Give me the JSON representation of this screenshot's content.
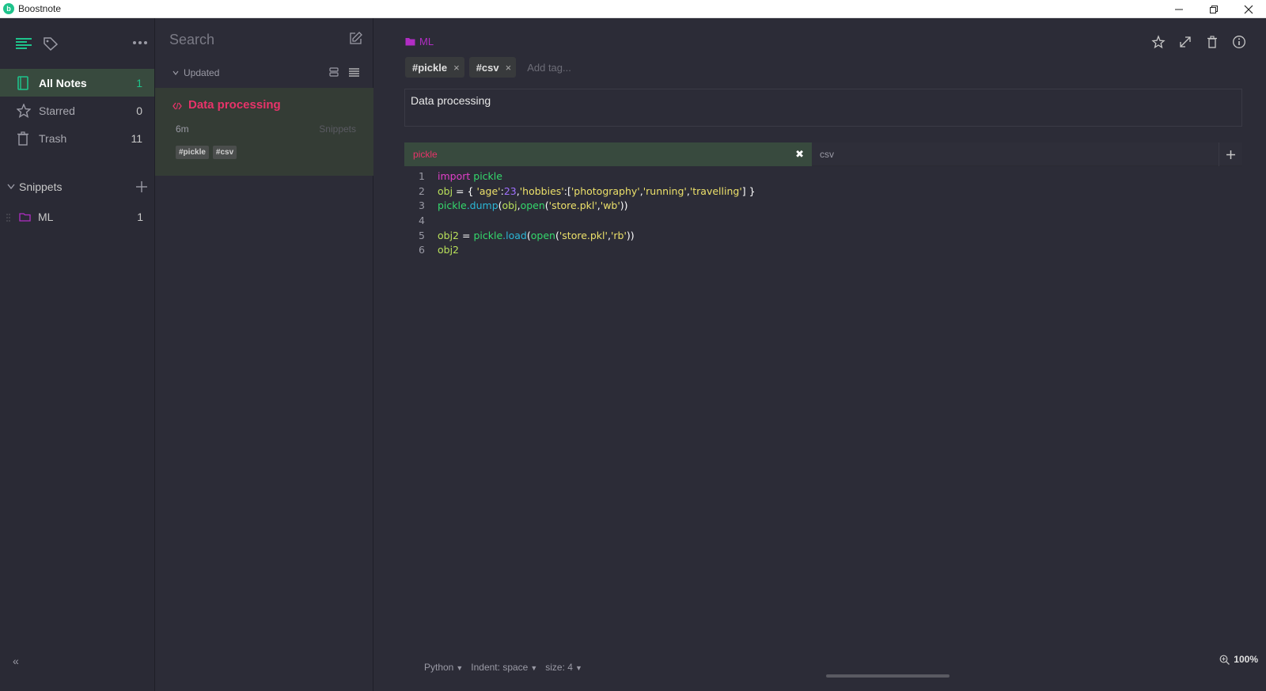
{
  "window": {
    "title": "Boostnote",
    "logo_glyph": "b"
  },
  "nav": {
    "items": [
      {
        "label": "All Notes",
        "count": "1"
      },
      {
        "label": "Starred",
        "count": "0"
      },
      {
        "label": "Trash",
        "count": "11"
      }
    ],
    "storage": {
      "label": "Snippets"
    },
    "folders": [
      {
        "label": "ML",
        "count": "1",
        "color": "#b12dc4"
      }
    ],
    "collapse_glyph": "«"
  },
  "notelist": {
    "search_placeholder": "Search",
    "sort_label": "Updated",
    "notes": [
      {
        "title": "Data processing",
        "time": "6m",
        "folder": "Snippets",
        "tags": [
          "#pickle",
          "#csv"
        ]
      }
    ]
  },
  "detail": {
    "folder": "ML",
    "tags": [
      {
        "label": "#pickle"
      },
      {
        "label": "#csv"
      }
    ],
    "tag_remove_glyph": "×",
    "add_tag_placeholder": "Add tag...",
    "description": "Data processing",
    "snippet_tabs": [
      {
        "label": "pickle"
      },
      {
        "label": "csv"
      }
    ],
    "tab_close_glyph": "✖",
    "code_lines": [
      {
        "n": "1"
      },
      {
        "n": "2"
      },
      {
        "n": "3"
      },
      {
        "n": "4"
      },
      {
        "n": "5"
      },
      {
        "n": "6"
      }
    ],
    "status": {
      "mode": "Python",
      "indent": "Indent: space",
      "size": "size: 4"
    },
    "zoom": "100%"
  },
  "colors": {
    "accent": "#1ec38b",
    "note_title": "#e8336a",
    "folder": "#b12dc4",
    "active_bg": "#384a3e"
  }
}
